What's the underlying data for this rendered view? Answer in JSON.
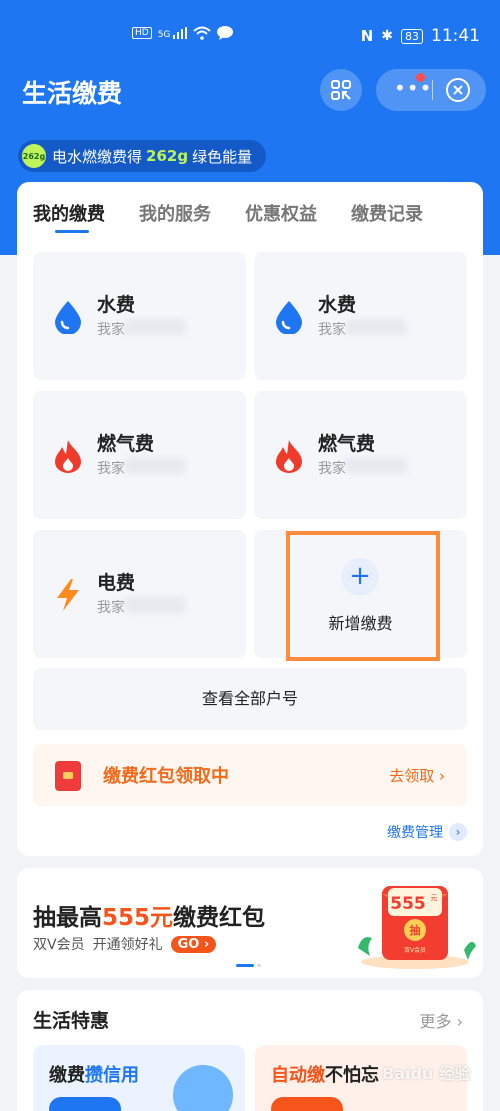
{
  "status_bar": {
    "hd": "HD",
    "signal": "5G",
    "battery": "83",
    "time": "11:41"
  },
  "header": {
    "title": "生活缴费"
  },
  "energy": {
    "badge": "262g",
    "prefix": "电水燃缴费得",
    "highlight": "262g",
    "suffix": "绿色能量"
  },
  "tabs": [
    {
      "label": "我的缴费",
      "active": true
    },
    {
      "label": "我的服务"
    },
    {
      "label": "优惠权益"
    },
    {
      "label": "缴费记录"
    }
  ],
  "tiles": [
    {
      "name": "水费",
      "sub": "我家",
      "icon": "water-drop-icon"
    },
    {
      "name": "水费",
      "sub": "我家",
      "icon": "water-drop-icon"
    },
    {
      "name": "燃气费",
      "sub": "我家",
      "icon": "flame-icon"
    },
    {
      "name": "燃气费",
      "sub": "我家",
      "icon": "flame-icon"
    },
    {
      "name": "电费",
      "sub": "我家",
      "icon": "lightning-icon"
    }
  ],
  "add_tile": {
    "plus": "+",
    "label": "新增缴费"
  },
  "view_all": "查看全部户号",
  "red_packet": {
    "text": "缴费红包领取中",
    "action": "去领取 ›"
  },
  "manage": "缴费管理",
  "banner": {
    "title_pre": "抽最高",
    "title_highlight": "555元",
    "title_post": "缴费红包",
    "sub_a": "双V会员",
    "sub_b": "开通领好礼",
    "go": "GO",
    "art_amount": "555",
    "art_unit": "元",
    "art_stamp": "抽",
    "art_caption": "双V会员"
  },
  "life": {
    "title": "生活特惠",
    "more": "更多",
    "promo1_a": "缴费",
    "promo1_b": "攒信用",
    "promo2_a": "自动缴",
    "promo2_b": "不怕忘"
  },
  "watermark": "Baidu 经验",
  "colors": {
    "primary": "#1f76f2",
    "orange": "#f5541b",
    "highlight_box": "#ff8b3d",
    "energy_green": "#bff35a"
  }
}
